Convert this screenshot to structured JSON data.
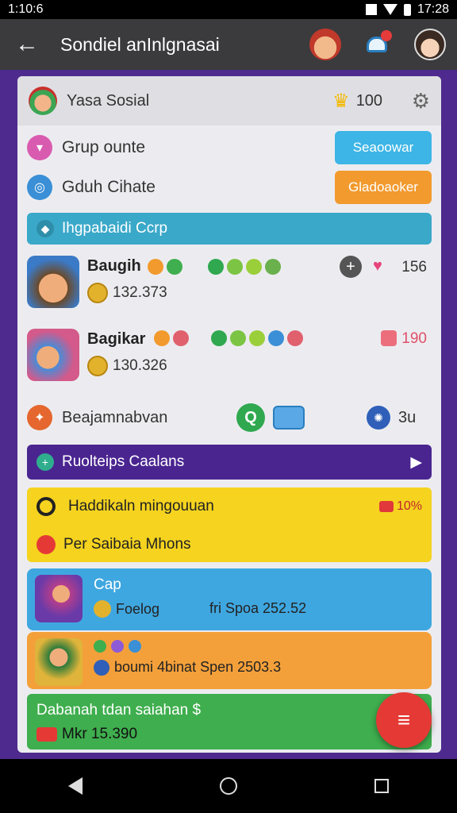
{
  "status_bar": {
    "time_left": "1:10:6",
    "time_right": "17:28"
  },
  "app_bar": {
    "title": "Sondiel anInlgnasai"
  },
  "header": {
    "name": "Yasa Sosial",
    "count": "100"
  },
  "options": [
    {
      "label": "Grup ounte",
      "button": "Seaoowar",
      "color": "#3db5e6"
    },
    {
      "label": "Gduh Cihate",
      "button": "Gladoaoker",
      "color": "#f29a2e"
    }
  ],
  "section_bar": {
    "label": "Ihgpabaidi Ccrp"
  },
  "players": [
    {
      "name": "Baugih",
      "points": "132.373",
      "score": "156"
    },
    {
      "name": "Bagikar",
      "points": "130.326",
      "score": "190"
    }
  ],
  "quick": {
    "label": "Beajamnabvan",
    "value": "3u"
  },
  "purple_bar": {
    "label": "Ruolteips Caalans"
  },
  "yellow": {
    "line1": "Haddikaln mingouuan",
    "badge": "10%",
    "line2": "Per Saibaia Mhons"
  },
  "promo1": {
    "line1": "Cap",
    "line2": "Foelog",
    "line3": "fri Spoa 252.52"
  },
  "promo2": {
    "line2": "boumi 4binat Spen 2503.3"
  },
  "green": {
    "line1": "Dabanah tdan saiahan $",
    "line2": "Mkr 15.390"
  },
  "colors": {
    "frame": "#4e2a8e",
    "cyan": "#3aa8c9",
    "purple": "#4a2590",
    "yellow": "#f5d31f",
    "blue": "#3fa7e0",
    "orange": "#f4a03a",
    "green": "#3fae4e",
    "fab": "#e53935"
  }
}
